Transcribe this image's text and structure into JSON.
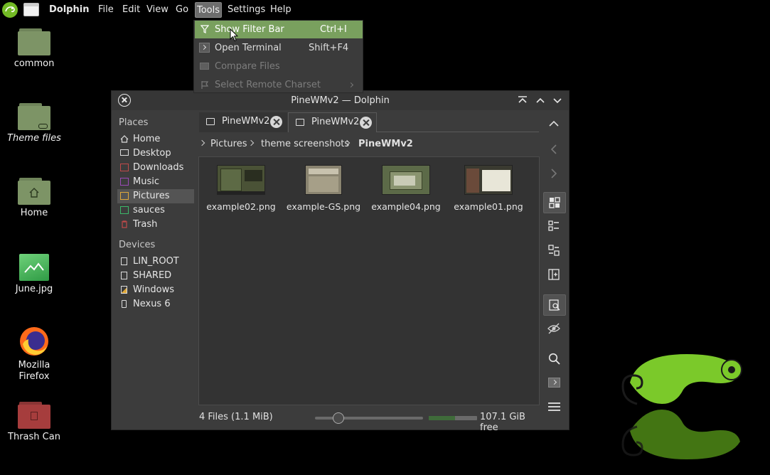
{
  "topbar": {
    "app_name": "Dolphin",
    "menus": [
      "File",
      "Edit",
      "View",
      "Go",
      "Tools",
      "Settings",
      "Help"
    ],
    "active_menu": "Tools"
  },
  "desktop": {
    "icons": [
      {
        "label": "common",
        "icon": "folder-icon"
      },
      {
        "label": "Theme files",
        "icon": "folder-link-icon"
      },
      {
        "label": "Home",
        "icon": "home-folder-icon"
      },
      {
        "label": "June.jpg",
        "icon": "image-file-icon"
      },
      {
        "label": "Mozilla\nFirefox",
        "icon": "firefox-icon"
      },
      {
        "label": "Thrash Can",
        "icon": "trash-folder-icon"
      }
    ]
  },
  "tools_menu": {
    "items": [
      {
        "label": "Show Filter Bar",
        "shortcut": "Ctrl+I",
        "icon": "filter-icon",
        "state": "highlighted"
      },
      {
        "label": "Open Terminal",
        "shortcut": "Shift+F4",
        "icon": "terminal-icon",
        "state": "normal"
      },
      {
        "label": "Compare Files",
        "shortcut": "",
        "icon": "compare-icon",
        "state": "disabled"
      },
      {
        "label": "Select Remote Charset",
        "shortcut": "",
        "icon": "charset-icon",
        "state": "disabled",
        "submenu": true
      }
    ]
  },
  "window": {
    "title": "PineWMv2 — Dolphin",
    "places": {
      "section_places": "Places",
      "items": [
        {
          "label": "Home",
          "icon": "home-icon",
          "color": "#dcdcdc"
        },
        {
          "label": "Desktop",
          "icon": "desktop-icon",
          "color": "#dcdcdc"
        },
        {
          "label": "Downloads",
          "icon": "downloads-folder-icon",
          "color": "#c04a4a"
        },
        {
          "label": "Music",
          "icon": "music-folder-icon",
          "color": "#9b4ab8"
        },
        {
          "label": "Pictures",
          "icon": "pictures-folder-icon",
          "color": "#e0a93a"
        },
        {
          "label": "sauces",
          "icon": "folder-icon",
          "color": "#3cb86a"
        },
        {
          "label": "Trash",
          "icon": "trash-icon",
          "color": "#c04a4a"
        }
      ],
      "selected": "Pictures",
      "section_devices": "Devices",
      "devices": [
        {
          "label": "LIN_ROOT",
          "icon": "drive-icon"
        },
        {
          "label": "SHARED",
          "icon": "drive-icon"
        },
        {
          "label": "Windows",
          "icon": "windows-drive-icon"
        },
        {
          "label": "Nexus 6",
          "icon": "phone-icon"
        }
      ]
    },
    "tabs": [
      {
        "label": "PineWMv2",
        "active": false
      },
      {
        "label": "PineWMv2",
        "active": true
      }
    ],
    "breadcrumb": [
      "Pictures",
      "theme screenshots",
      "PineWMv2"
    ],
    "files": [
      {
        "name": "example02.png"
      },
      {
        "name": "example-GS.png"
      },
      {
        "name": "example04.png"
      },
      {
        "name": "example01.png"
      }
    ],
    "status": {
      "summary": "4 Files (1.1 MiB)",
      "zoom_fraction": 0.22,
      "disk_used_fraction": 0.55,
      "free_space": "107.1 GiB free"
    }
  },
  "colors": {
    "accent": "#79a05e",
    "opensuse_green": "#73ba25"
  }
}
